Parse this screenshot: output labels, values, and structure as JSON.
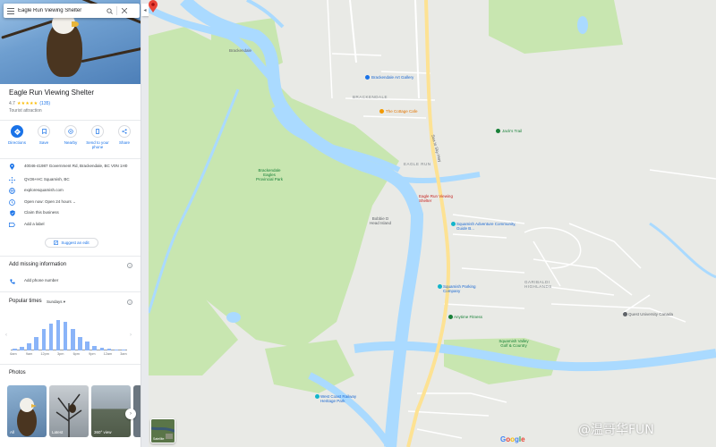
{
  "search": {
    "value": "Eagle Run Viewing Shelter"
  },
  "place": {
    "title": "Eagle Run Viewing Shelter",
    "rating": "4.7",
    "stars": "★★★★★",
    "reviews": "(135)",
    "category": "Tourist attraction"
  },
  "actions": [
    {
      "label": "Directions",
      "icon": "directions-icon"
    },
    {
      "label": "Save",
      "icon": "bookmark-icon"
    },
    {
      "label": "Nearby",
      "icon": "nearby-icon"
    },
    {
      "label": "Send to your phone",
      "icon": "phone-icon"
    },
    {
      "label": "Share",
      "icon": "share-icon"
    }
  ],
  "info": {
    "address": "40046-41987 Government Rd, Brackendale, BC V0N 1H0",
    "plus_code": "QV26+HC Squamish, BC",
    "website": "exploresquamish.com",
    "hours": "Open now:  Open 24 hours",
    "claim": "Claim this business",
    "add_label": "Add a label",
    "suggest_edit": "Suggest an edit"
  },
  "missing": {
    "heading": "Add missing information",
    "add_phone": "Add phone number"
  },
  "popular": {
    "heading": "Popular times",
    "day": "Sundays",
    "ticks": [
      "6am",
      "9am",
      "12pm",
      "3pm",
      "6pm",
      "9pm",
      "12am",
      "3am"
    ],
    "values": [
      0.05,
      0.12,
      0.25,
      0.45,
      0.7,
      0.88,
      1.0,
      0.95,
      0.7,
      0.45,
      0.28,
      0.16,
      0.1,
      0.06,
      0.03,
      0.02
    ]
  },
  "photos": {
    "heading": "Photos",
    "items": [
      {
        "label": "All"
      },
      {
        "label": "Latest"
      },
      {
        "label": "360° view"
      },
      {
        "label": ""
      }
    ]
  },
  "map": {
    "labels": {
      "bracken": "Brackendale",
      "brackendale_area": "BRACKENDALE",
      "art_gallery": "Brackendale Art Gallery",
      "cottage_cafe": "The Cottage Cafe",
      "jacks": "Jack's Trail",
      "eagle_run": "EAGLE RUN",
      "pin_label": "Eagle Run Viewing Shelter",
      "sea_to_sky": "Sea to Sky Hwy",
      "park": "Brackendale Eagles Provincial Park",
      "bobbie": "Bobbie D Head Island",
      "squamish_adventure": "Squamish Adventure Community, Guide B...",
      "garibaldi": "GARIBALDI HIGHLANDS",
      "squamish_parking": "Squamish Parking Company",
      "anytime": "Anytime Fitness",
      "quest": "Quest University Canada",
      "valley_golf": "Squamish Valley Golf & Country",
      "west_coast": "West Coast Railway Heritage Park",
      "satellite": "Satellite",
      "watermark": "@温哥华FUN"
    },
    "colors": {
      "land": "#e9eae6",
      "water": "#aadaff",
      "park": "#c8e6b0",
      "road_major": "#fde293",
      "pin": "#ea4335"
    }
  },
  "google": {
    "G": "G",
    "o1": "o",
    "o2": "o",
    "g": "g",
    "l": "l",
    "e": "e"
  }
}
